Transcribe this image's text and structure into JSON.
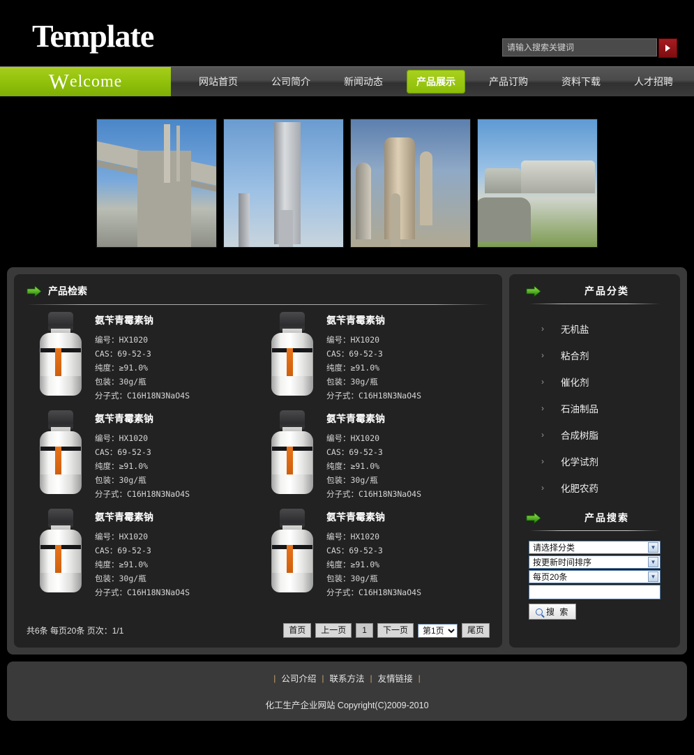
{
  "header": {
    "logo": "Template",
    "search": {
      "placeholder": "请输入搜索关键词",
      "value": "",
      "button_icon": "play-triangle-icon"
    }
  },
  "nav": {
    "welcome_first": "W",
    "welcome_rest": "elcome",
    "items": [
      {
        "label": "网站首页",
        "active": false
      },
      {
        "label": "公司简介",
        "active": false
      },
      {
        "label": "新闻动态",
        "active": false
      },
      {
        "label": "产品展示",
        "active": true
      },
      {
        "label": "产品订购",
        "active": false
      },
      {
        "label": "资料下载",
        "active": false
      },
      {
        "label": "人才招聘",
        "active": false
      }
    ]
  },
  "banner": {
    "images": [
      {
        "alt": "水泥输送廊道与烟囱"
      },
      {
        "alt": "炼油精馏塔"
      },
      {
        "alt": "化工管道与反应器"
      },
      {
        "alt": "石油储罐区"
      }
    ]
  },
  "content": {
    "title": "产品检索",
    "products": [
      {
        "name": "氨苄青霉素钠",
        "code_label": "编号：",
        "code": "HX1020",
        "cas_label": "CAS：",
        "cas": "69-52-3",
        "purity_label": "纯度：",
        "purity": "≥91.0%",
        "package_label": "包装：",
        "package": "30g/瓶",
        "formula_label": "分子式：",
        "formula": "C16H18N3NaO4S"
      },
      {
        "name": "氨苄青霉素钠",
        "code_label": "编号：",
        "code": "HX1020",
        "cas_label": "CAS：",
        "cas": "69-52-3",
        "purity_label": "纯度：",
        "purity": "≥91.0%",
        "package_label": "包装：",
        "package": "30g/瓶",
        "formula_label": "分子式：",
        "formula": "C16H18N3NaO4S"
      },
      {
        "name": "氨苄青霉素钠",
        "code_label": "编号：",
        "code": "HX1020",
        "cas_label": "CAS：",
        "cas": "69-52-3",
        "purity_label": "纯度：",
        "purity": "≥91.0%",
        "package_label": "包装：",
        "package": "30g/瓶",
        "formula_label": "分子式：",
        "formula": "C16H18N3NaO4S"
      },
      {
        "name": "氨苄青霉素钠",
        "code_label": "编号：",
        "code": "HX1020",
        "cas_label": "CAS：",
        "cas": "69-52-3",
        "purity_label": "纯度：",
        "purity": "≥91.0%",
        "package_label": "包装：",
        "package": "30g/瓶",
        "formula_label": "分子式：",
        "formula": "C16H18N3NaO4S"
      },
      {
        "name": "氨苄青霉素钠",
        "code_label": "编号：",
        "code": "HX1020",
        "cas_label": "CAS：",
        "cas": "69-52-3",
        "purity_label": "纯度：",
        "purity": "≥91.0%",
        "package_label": "包装：",
        "package": "30g/瓶",
        "formula_label": "分子式：",
        "formula": "C16H18N3NaO4S"
      },
      {
        "name": "氨苄青霉素钠",
        "code_label": "编号：",
        "code": "HX1020",
        "cas_label": "CAS：",
        "cas": "69-52-3",
        "purity_label": "纯度：",
        "purity": "≥91.0%",
        "package_label": "包装：",
        "package": "30g/瓶",
        "formula_label": "分子式：",
        "formula": "C16H18N3NaO4S"
      }
    ],
    "pager": {
      "stats": "共6条 每页20条 页次：1/1",
      "first": "首页",
      "prev": "上一页",
      "current_num": "1",
      "next": "下一页",
      "page_select": "第1页",
      "last": "尾页"
    }
  },
  "sidebar": {
    "category_title": "产品分类",
    "categories": [
      {
        "label": "无机盐"
      },
      {
        "label": "粘合剂"
      },
      {
        "label": "催化剂"
      },
      {
        "label": "石油制品"
      },
      {
        "label": "合成树脂"
      },
      {
        "label": "化学试剂"
      },
      {
        "label": "化肥农药"
      }
    ],
    "search_title": "产品搜索",
    "search": {
      "category_select": "请选择分类",
      "sort_select": "按更新时间排序",
      "perpage_select": "每页20条",
      "keyword_value": "",
      "button_label": "搜 索"
    }
  },
  "footer": {
    "links": [
      "公司介绍",
      "联系方法",
      "友情链接"
    ],
    "copyright": "化工生产企业网站 Copyright(C)2009-2010"
  },
  "colors": {
    "accent_green": "#9ac80f",
    "page_bg": "#000000",
    "panel_bg": "#222222",
    "wrap_bg": "#3a3a3a",
    "search_btn_red": "#a51c20"
  }
}
